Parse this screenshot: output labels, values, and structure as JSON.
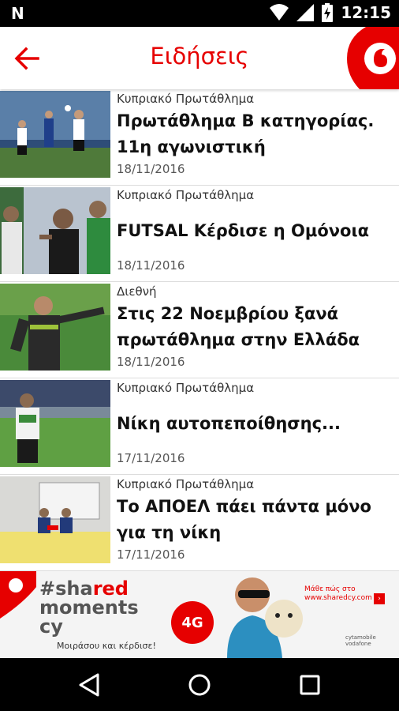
{
  "status_bar": {
    "left_glyph": "N",
    "time": "12:15",
    "icons": [
      "wifi-icon",
      "signal-icon",
      "battery-charging-icon"
    ]
  },
  "app_bar": {
    "title": "Ειδήσεις",
    "back_icon": "arrow-left-icon",
    "logo": "vodafone-logo",
    "accent_color": "#e60000"
  },
  "news": [
    {
      "category": "Κυπριακό Πρωτάθλημα",
      "title": "Πρωτάθλημα Β κατηγορίας. 11η αγωνιστική",
      "date": "18/11/2016"
    },
    {
      "category": "Κυπριακό Πρωτάθλημα",
      "title": "FUTSAL Κέρδισε η Ομόνοια",
      "date": "18/11/2016"
    },
    {
      "category": "Διεθνή",
      "title": "Στις 22 Νοεμβρίου ξανά πρωτάθλημα στην Ελλάδα",
      "date": "18/11/2016"
    },
    {
      "category": "Κυπριακό Πρωτάθλημα",
      "title": "Νίκη αυτοπεποίθησης...",
      "date": "17/11/2016"
    },
    {
      "category": "Κυπριακό Πρωτάθλημα",
      "title": "Το ΑΠΟΕΛ πάει πάντα μόνο για τη νίκη",
      "date": "17/11/2016"
    }
  ],
  "banner": {
    "hashtag_prefix": "#sha",
    "hashtag_red": "red",
    "line2": "moments",
    "line3": "cy",
    "tagline": "Μοιράσου και κέρδισε!",
    "badge": "4G",
    "cta_line1": "Μάθε πώς στο",
    "cta_line2": "www.sharedcy.com",
    "arrow": "›",
    "brands": "cytamobile  vodafone"
  },
  "nav_bar": {
    "icons": [
      "back-triangle-icon",
      "home-circle-icon",
      "recents-square-icon"
    ]
  }
}
